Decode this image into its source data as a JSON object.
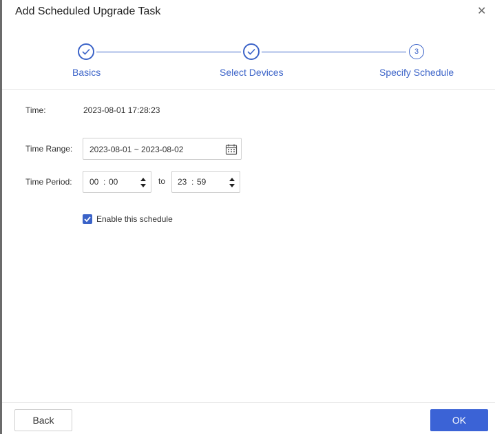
{
  "dialog": {
    "title": "Add Scheduled Upgrade Task",
    "close_glyph": "✕"
  },
  "stepper": {
    "steps": [
      {
        "label": "Basics",
        "status": "completed",
        "icon": "check-icon"
      },
      {
        "label": "Select Devices",
        "status": "completed",
        "icon": "check-icon"
      },
      {
        "label": "Specify Schedule",
        "status": "current",
        "number": "3"
      }
    ]
  },
  "form": {
    "time_label": "Time:",
    "time_value": "2023-08-01 17:28:23",
    "range_label": "Time Range:",
    "range_value": "2023-08-01 ~ 2023-08-02",
    "period_label": "Time Period:",
    "start_hour": "00",
    "start_minute": "00",
    "separator": ":",
    "to_label": "to",
    "end_hour": "23",
    "end_minute": "59",
    "enable_label": "Enable this schedule",
    "enable_checked": true
  },
  "footer": {
    "back_label": "Back",
    "ok_label": "OK"
  },
  "colors": {
    "accent": "#3b63c8",
    "primary_button": "#3b63d6"
  }
}
